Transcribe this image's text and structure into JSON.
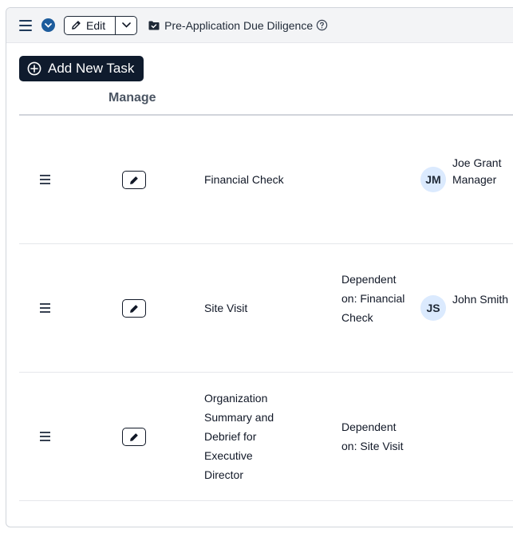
{
  "toolbar": {
    "edit_label": "Edit",
    "breadcrumb_title": "Pre-Application Due Diligence"
  },
  "actions": {
    "add_task_label": "Add New Task"
  },
  "table": {
    "manage_header": "Manage",
    "rows": [
      {
        "task": "Financial Check",
        "dependency": "",
        "assignee_initials": "JM",
        "assignee": "Joe Grant Manager"
      },
      {
        "task": "Site Visit",
        "dependency": "Dependent on: Financial Check",
        "assignee_initials": "JS",
        "assignee": "John Smith"
      },
      {
        "task": "Organization Summary and Debrief for Executive Director",
        "dependency": "Dependent on: Site Visit",
        "assignee_initials": "",
        "assignee": ""
      }
    ]
  },
  "colors": {
    "primary_dark": "#0f1b2d",
    "accent_blue": "#1d5c9c",
    "avatar_bg": "#dbeafe"
  },
  "icons": [
    "hamburger-icon",
    "chevron-down-circle-icon",
    "pencil-icon",
    "chevron-down-icon",
    "folder-check-icon",
    "help-circle-icon",
    "plus-circle-icon",
    "drag-handle-icon"
  ]
}
